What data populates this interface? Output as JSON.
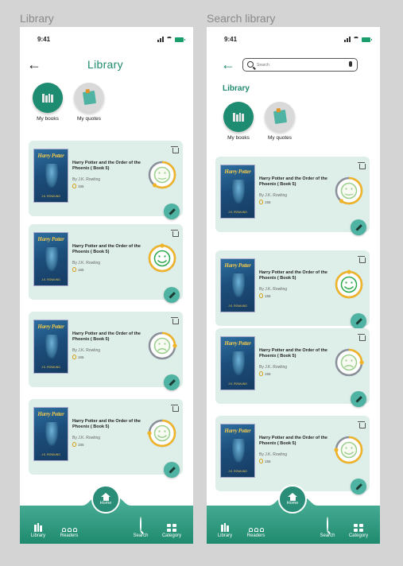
{
  "screens": [
    {
      "label": "Library",
      "status_time": "9:41",
      "title": "Library",
      "categories": [
        {
          "label": "My books",
          "icon": "books-icon"
        },
        {
          "label": "My quotes",
          "icon": "quote-note-icon"
        }
      ],
      "books": [
        {
          "title": "Harry Potter and the Order of the Phoenix ( Book 5)",
          "author": "By J.K. Rowling",
          "pages": "155",
          "mood": "neutral",
          "progress": 0.6
        },
        {
          "title": "Harry Potter and the Order of the Phoenix ( Book 5)",
          "author": "By J.K. Rowling",
          "pages": "155",
          "mood": "happy",
          "progress": 1.0
        },
        {
          "title": "Harry Potter and the Order of the Phoenix ( Book 5)",
          "author": "By J.K. Rowling",
          "pages": "155",
          "mood": "sad",
          "progress": 0.25
        },
        {
          "title": "Harry Potter and the Order of the Phoenix ( Book 5)",
          "author": "By J.K. Rowling",
          "pages": "155",
          "mood": "content",
          "progress": 0.75
        }
      ]
    },
    {
      "label": "Search  library",
      "status_time": "9:41",
      "search_placeholder": "Search",
      "section_title": "Library",
      "categories": [
        {
          "label": "My books",
          "icon": "books-icon"
        },
        {
          "label": "My quotes",
          "icon": "quote-note-icon"
        }
      ],
      "books": [
        {
          "title": "Harry Potter and the Order of the Phoenix ( Book 5)",
          "author": "By J.K. Rowling",
          "pages": "155",
          "mood": "neutral",
          "progress": 0.6
        },
        {
          "title": "Harry Potter and the Order of the Phoenix ( Book 5)",
          "author": "By J.K. Rowling",
          "pages": "155",
          "mood": "happy",
          "progress": 1.0
        },
        {
          "title": "Harry Potter and the Order of the Phoenix ( Book 5)",
          "author": "By J.K. Rowling",
          "pages": "155",
          "mood": "sad",
          "progress": 0.25
        },
        {
          "title": "Harry Potter and the Order of the Phoenix ( Book 5)",
          "author": "By J.K. Rowling",
          "pages": "155",
          "mood": "content",
          "progress": 0.75
        }
      ]
    }
  ],
  "cover": {
    "series": "Harry Potter",
    "author": "J.K. ROWLING"
  },
  "tabbar": {
    "library": "Library",
    "readers": "Readers",
    "home": "Home",
    "search": "Search",
    "category": "Category"
  },
  "colors": {
    "accent": "#1f8a6e",
    "card": "#deefe9",
    "progress": "#f0b429",
    "track": "#8a8f99",
    "face_happy": "#2aa84a",
    "face_muted": "#9ccf8f"
  }
}
